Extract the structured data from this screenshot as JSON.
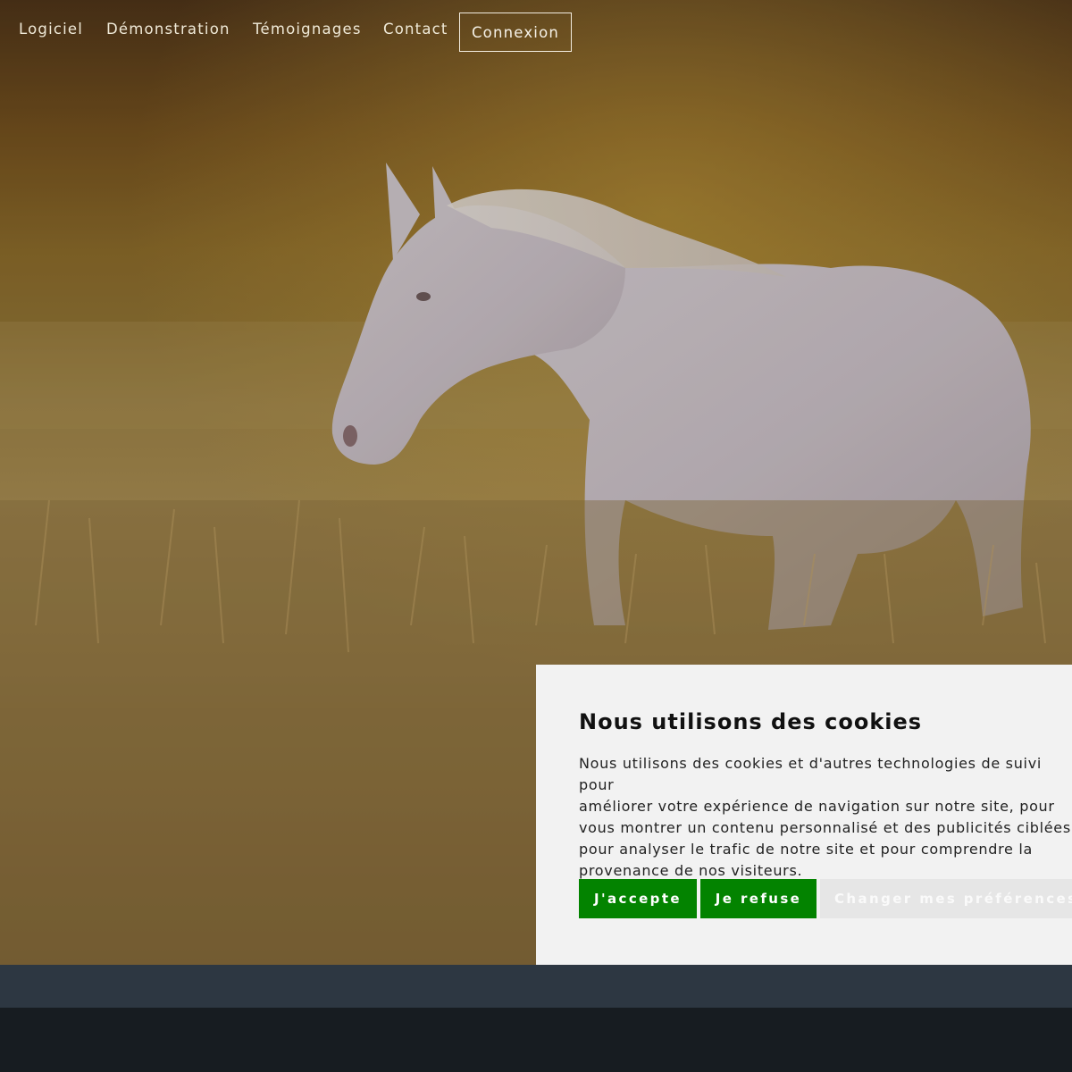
{
  "nav": {
    "items": [
      {
        "label": "Logiciel"
      },
      {
        "label": "Démonstration"
      },
      {
        "label": "Témoignages"
      },
      {
        "label": "Contact"
      }
    ],
    "login_label": "Connexion"
  },
  "cookie_banner": {
    "title": "Nous utilisons des cookies",
    "body": "Nous utilisons des cookies et d'autres technologies de suivi pour\naméliorer votre expérience de navigation sur notre site, pour\nvous montrer un contenu personnalisé et des publicités ciblées,\npour analyser le trafic de notre site et pour comprendre la\nprovenance de nos visiteurs.",
    "accept_label": "J'accepte",
    "refuse_label": "Je refuse",
    "preferences_label": "Changer mes préférences"
  },
  "colors": {
    "accept_button": "#038300",
    "refuse_button": "#038300",
    "banner_background": "#f2f2f2",
    "strip": "#2d3742",
    "footer": "#171c21"
  }
}
